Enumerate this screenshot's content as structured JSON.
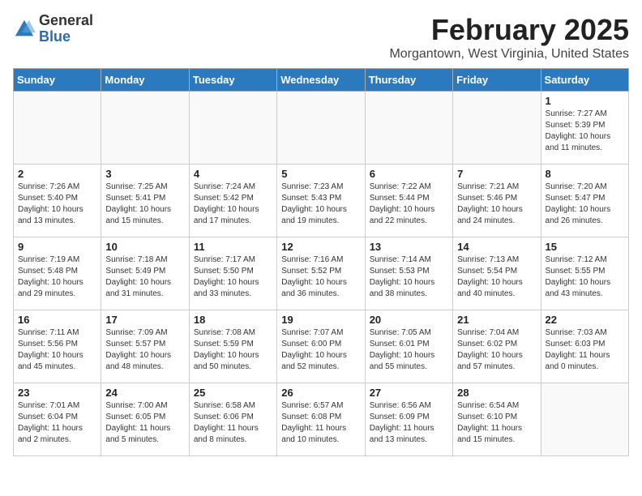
{
  "header": {
    "logo_general": "General",
    "logo_blue": "Blue",
    "month_title": "February 2025",
    "location": "Morgantown, West Virginia, United States"
  },
  "weekdays": [
    "Sunday",
    "Monday",
    "Tuesday",
    "Wednesday",
    "Thursday",
    "Friday",
    "Saturday"
  ],
  "weeks": [
    [
      {
        "day": "",
        "info": ""
      },
      {
        "day": "",
        "info": ""
      },
      {
        "day": "",
        "info": ""
      },
      {
        "day": "",
        "info": ""
      },
      {
        "day": "",
        "info": ""
      },
      {
        "day": "",
        "info": ""
      },
      {
        "day": "1",
        "info": "Sunrise: 7:27 AM\nSunset: 5:39 PM\nDaylight: 10 hours\nand 11 minutes."
      }
    ],
    [
      {
        "day": "2",
        "info": "Sunrise: 7:26 AM\nSunset: 5:40 PM\nDaylight: 10 hours\nand 13 minutes."
      },
      {
        "day": "3",
        "info": "Sunrise: 7:25 AM\nSunset: 5:41 PM\nDaylight: 10 hours\nand 15 minutes."
      },
      {
        "day": "4",
        "info": "Sunrise: 7:24 AM\nSunset: 5:42 PM\nDaylight: 10 hours\nand 17 minutes."
      },
      {
        "day": "5",
        "info": "Sunrise: 7:23 AM\nSunset: 5:43 PM\nDaylight: 10 hours\nand 19 minutes."
      },
      {
        "day": "6",
        "info": "Sunrise: 7:22 AM\nSunset: 5:44 PM\nDaylight: 10 hours\nand 22 minutes."
      },
      {
        "day": "7",
        "info": "Sunrise: 7:21 AM\nSunset: 5:46 PM\nDaylight: 10 hours\nand 24 minutes."
      },
      {
        "day": "8",
        "info": "Sunrise: 7:20 AM\nSunset: 5:47 PM\nDaylight: 10 hours\nand 26 minutes."
      }
    ],
    [
      {
        "day": "9",
        "info": "Sunrise: 7:19 AM\nSunset: 5:48 PM\nDaylight: 10 hours\nand 29 minutes."
      },
      {
        "day": "10",
        "info": "Sunrise: 7:18 AM\nSunset: 5:49 PM\nDaylight: 10 hours\nand 31 minutes."
      },
      {
        "day": "11",
        "info": "Sunrise: 7:17 AM\nSunset: 5:50 PM\nDaylight: 10 hours\nand 33 minutes."
      },
      {
        "day": "12",
        "info": "Sunrise: 7:16 AM\nSunset: 5:52 PM\nDaylight: 10 hours\nand 36 minutes."
      },
      {
        "day": "13",
        "info": "Sunrise: 7:14 AM\nSunset: 5:53 PM\nDaylight: 10 hours\nand 38 minutes."
      },
      {
        "day": "14",
        "info": "Sunrise: 7:13 AM\nSunset: 5:54 PM\nDaylight: 10 hours\nand 40 minutes."
      },
      {
        "day": "15",
        "info": "Sunrise: 7:12 AM\nSunset: 5:55 PM\nDaylight: 10 hours\nand 43 minutes."
      }
    ],
    [
      {
        "day": "16",
        "info": "Sunrise: 7:11 AM\nSunset: 5:56 PM\nDaylight: 10 hours\nand 45 minutes."
      },
      {
        "day": "17",
        "info": "Sunrise: 7:09 AM\nSunset: 5:57 PM\nDaylight: 10 hours\nand 48 minutes."
      },
      {
        "day": "18",
        "info": "Sunrise: 7:08 AM\nSunset: 5:59 PM\nDaylight: 10 hours\nand 50 minutes."
      },
      {
        "day": "19",
        "info": "Sunrise: 7:07 AM\nSunset: 6:00 PM\nDaylight: 10 hours\nand 52 minutes."
      },
      {
        "day": "20",
        "info": "Sunrise: 7:05 AM\nSunset: 6:01 PM\nDaylight: 10 hours\nand 55 minutes."
      },
      {
        "day": "21",
        "info": "Sunrise: 7:04 AM\nSunset: 6:02 PM\nDaylight: 10 hours\nand 57 minutes."
      },
      {
        "day": "22",
        "info": "Sunrise: 7:03 AM\nSunset: 6:03 PM\nDaylight: 11 hours\nand 0 minutes."
      }
    ],
    [
      {
        "day": "23",
        "info": "Sunrise: 7:01 AM\nSunset: 6:04 PM\nDaylight: 11 hours\nand 2 minutes."
      },
      {
        "day": "24",
        "info": "Sunrise: 7:00 AM\nSunset: 6:05 PM\nDaylight: 11 hours\nand 5 minutes."
      },
      {
        "day": "25",
        "info": "Sunrise: 6:58 AM\nSunset: 6:06 PM\nDaylight: 11 hours\nand 8 minutes."
      },
      {
        "day": "26",
        "info": "Sunrise: 6:57 AM\nSunset: 6:08 PM\nDaylight: 11 hours\nand 10 minutes."
      },
      {
        "day": "27",
        "info": "Sunrise: 6:56 AM\nSunset: 6:09 PM\nDaylight: 11 hours\nand 13 minutes."
      },
      {
        "day": "28",
        "info": "Sunrise: 6:54 AM\nSunset: 6:10 PM\nDaylight: 11 hours\nand 15 minutes."
      },
      {
        "day": "",
        "info": ""
      }
    ]
  ]
}
